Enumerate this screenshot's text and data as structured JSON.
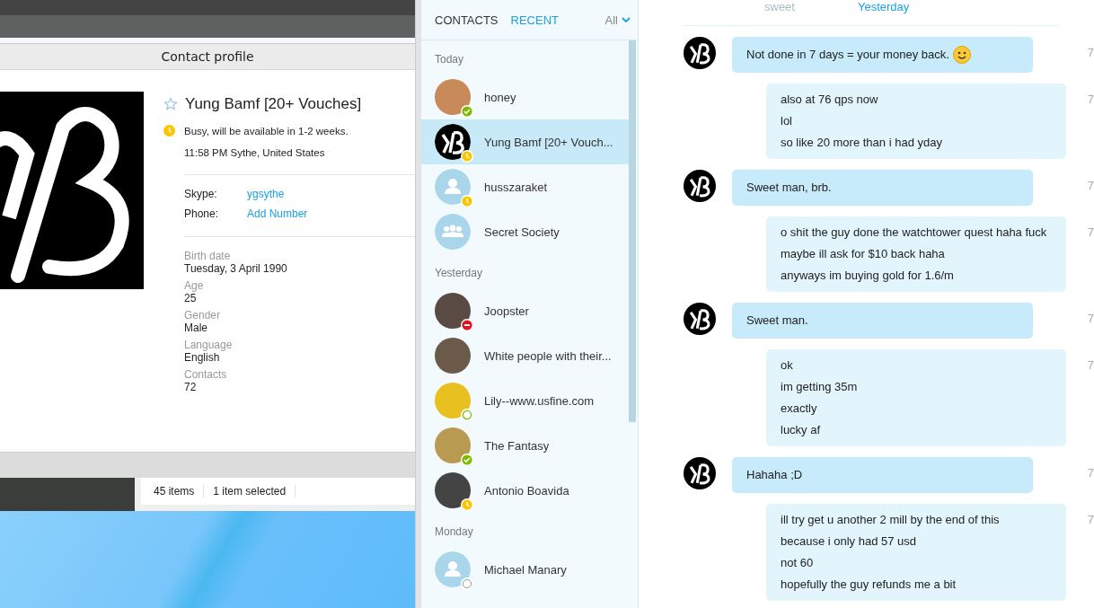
{
  "profile_window": {
    "title": "Contact profile",
    "name": "Yung Bamf [20+ Vouches]",
    "favorite": false,
    "mood": "Busy, will be available in 1-2 weeks.",
    "status_icon": {
      "kind": "away"
    },
    "local_time": "11:58 PM Sythe, United States",
    "accounts": [
      {
        "label": "Skype:",
        "value": "ygsythe"
      },
      {
        "label": "Phone:",
        "value": "Add Number"
      }
    ],
    "details": [
      {
        "label": "Birth date",
        "value": "Tuesday, 3 April 1990"
      },
      {
        "label": "Age",
        "value": "25"
      },
      {
        "label": "Gender",
        "value": "Male"
      },
      {
        "label": "Language",
        "value": "English"
      },
      {
        "label": "Contacts",
        "value": "72"
      }
    ]
  },
  "explorer_status": {
    "items": "45 items",
    "selection": "1 item selected"
  },
  "sidebar": {
    "tabs": [
      {
        "label": "CONTACTS",
        "selected": false
      },
      {
        "label": "RECENT",
        "selected": true
      }
    ],
    "filter": "All",
    "groups": [
      {
        "heading": "Today",
        "items": [
          {
            "name": "honey",
            "avatar": {
              "kind": "photo",
              "color": "#c98a5a"
            },
            "badge": {
              "kind": "online"
            },
            "selected": false
          },
          {
            "name": "Yung Bamf [20+ Vouch...",
            "avatar": {
              "kind": "monogram"
            },
            "badge": {
              "kind": "away"
            },
            "selected": true
          },
          {
            "name": "husszaraket",
            "avatar": {
              "kind": "person"
            },
            "badge": {
              "kind": "away"
            },
            "selected": false
          },
          {
            "name": "Secret Society",
            "avatar": {
              "kind": "group"
            },
            "selected": false
          }
        ]
      },
      {
        "heading": "Yesterday",
        "items": [
          {
            "name": "Joopster",
            "avatar": {
              "kind": "photo",
              "color": "#5a4a44"
            },
            "badge": {
              "kind": "dnd"
            },
            "selected": false
          },
          {
            "name": "White people with their...",
            "avatar": {
              "kind": "photo",
              "color": "#6b5a4a"
            },
            "selected": false
          },
          {
            "name": "Lily--www.usfine.com",
            "avatar": {
              "kind": "photo",
              "color": "#e8c020"
            },
            "badge": {
              "kind": "offline"
            },
            "selected": false
          },
          {
            "name": "The Fantasy",
            "avatar": {
              "kind": "photo",
              "color": "#b89a50"
            },
            "badge": {
              "kind": "online"
            },
            "selected": false
          },
          {
            "name": "Antonio Boavida",
            "avatar": {
              "kind": "photo",
              "color": "#444444"
            },
            "badge": {
              "kind": "away"
            },
            "selected": false
          }
        ]
      },
      {
        "heading": "Monday",
        "items": [
          {
            "name": "Michael Manary",
            "avatar": {
              "kind": "person"
            },
            "badge": {
              "kind": "unknown"
            },
            "selected": false
          }
        ]
      }
    ]
  },
  "chat": {
    "faded_text": "sweet",
    "date_divider": "Yesterday",
    "messages": [
      {
        "kind": "incoming",
        "lines": [
          "Not done in 7 days = your money back."
        ],
        "emoticon": true,
        "time": "7"
      },
      {
        "kind": "outgoing",
        "lines": [
          "also at 76 qps now",
          "lol",
          "so like 20 more than i had yday"
        ],
        "emoticon": false,
        "time": "7"
      },
      {
        "kind": "incoming",
        "lines": [
          "Sweet man, brb."
        ],
        "emoticon": false,
        "time": "7"
      },
      {
        "kind": "outgoing",
        "lines": [
          "o shit the guy done the watchtower quest haha fuck",
          "maybe ill ask for $10 back haha",
          "anyways im buying gold for 1.6/m"
        ],
        "emoticon": false,
        "time": "7"
      },
      {
        "kind": "incoming",
        "lines": [
          "Sweet man."
        ],
        "emoticon": false,
        "time": "7"
      },
      {
        "kind": "outgoing",
        "lines": [
          "ok",
          "im getting 35m",
          "exactly",
          "lucky af"
        ],
        "emoticon": false,
        "time": "7"
      },
      {
        "kind": "incoming",
        "lines": [
          "Hahaha ;D"
        ],
        "emoticon": false,
        "time": "7"
      },
      {
        "kind": "outgoing",
        "lines": [
          "ill try get u another 2 mill by the end of this",
          "because i only had 57 usd",
          "not 60",
          "hopefully the guy refunds me a bit"
        ],
        "emoticon": false,
        "time": "7"
      }
    ]
  }
}
